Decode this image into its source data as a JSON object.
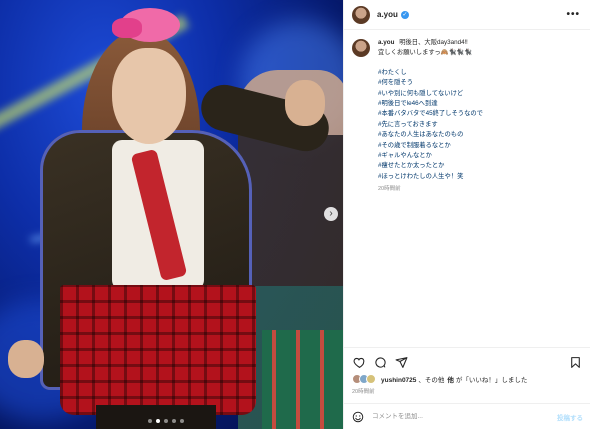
{
  "post": {
    "username": "a.you",
    "caption_intro": "明後日、大阪day3and4‼︎",
    "caption_line2": "宜しくお願いしますっ🙈🐈‍⬛🐈‍⬛🐈‍⬛",
    "hashtags": [
      "#わたくし",
      "#何を隠そう",
      "#いや別に何も隠してないけど",
      "#明後日でle46へ到達",
      "#本番バタバタで45終了しそうなので",
      "#先に言っておきます",
      "#あなたの人生はあなたのもの",
      "#その歳で制服着るなとか",
      "#ギャルやんなとか",
      "#痩せたとか太ったとか",
      "#ほっとけわたしの人生や！笑"
    ],
    "caption_time": "20時間前",
    "more_icon": "•••"
  },
  "likes": {
    "liker": "yushin0725",
    "text_before": "、その他",
    "text_after": "が「いいね！」しました"
  },
  "post_time": "20時間前",
  "comment": {
    "placeholder": "コメントを追加...",
    "post_label": "投稿する"
  },
  "carousel": {
    "count": 5,
    "active_index": 1,
    "next_glyph": "›"
  },
  "colors": {
    "hashtag": "#00376b",
    "verified": "#3897f0",
    "muted": "#8e8e8e",
    "post_button": "#b2dffc"
  },
  "icons": [
    "heart-icon",
    "comment-icon",
    "share-icon",
    "bookmark-icon",
    "emoji-icon",
    "more-options-icon",
    "verified-badge-icon",
    "chevron-right-icon"
  ]
}
